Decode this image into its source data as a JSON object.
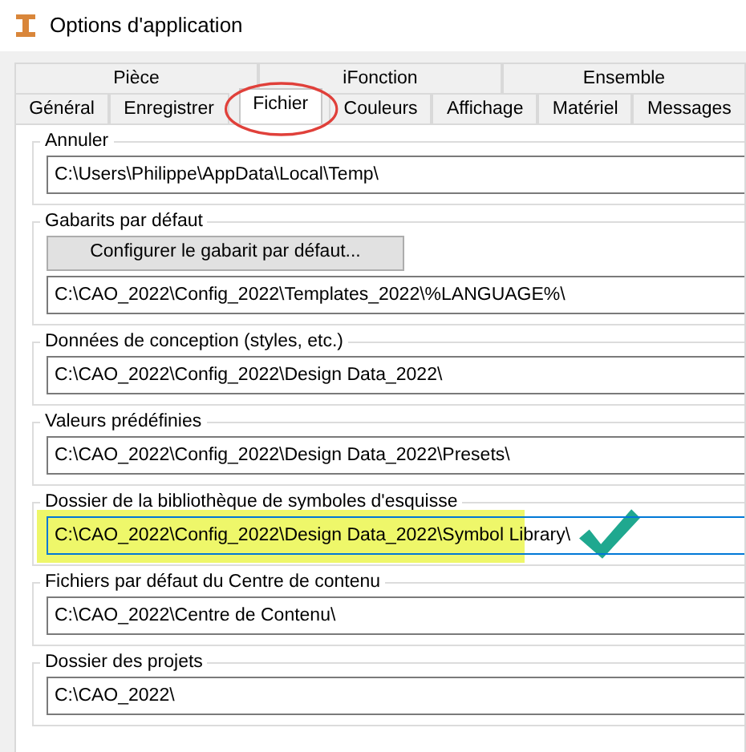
{
  "window": {
    "title": "Options d'application"
  },
  "tabs_top": [
    {
      "label": "Pièce"
    },
    {
      "label": "iFonction"
    },
    {
      "label": "Ensemble"
    }
  ],
  "tabs": [
    {
      "label": "Général",
      "selected": false,
      "circled": false
    },
    {
      "label": "Enregistrer",
      "selected": false,
      "circled": false
    },
    {
      "label": "Fichier",
      "selected": true,
      "circled": true
    },
    {
      "label": "Couleurs",
      "selected": false,
      "circled": false
    },
    {
      "label": "Affichage",
      "selected": false,
      "circled": false
    },
    {
      "label": "Matériel",
      "selected": false,
      "circled": false
    },
    {
      "label": "Messages",
      "selected": false,
      "circled": false
    }
  ],
  "groups": [
    {
      "legend": "Annuler",
      "value": "C:\\Users\\Philippe\\AppData\\Local\\Temp\\",
      "focused": false,
      "highlighted": false,
      "checkmark": false
    },
    {
      "legend": "Gabarits par défaut",
      "button": "Configurer le gabarit par défaut...",
      "value": "C:\\CAO_2022\\Config_2022\\Templates_2022\\%LANGUAGE%\\",
      "focused": false,
      "highlighted": false,
      "checkmark": false
    },
    {
      "legend": "Données de conception (styles, etc.)",
      "value": "C:\\CAO_2022\\Config_2022\\Design Data_2022\\",
      "focused": false,
      "highlighted": false,
      "checkmark": false
    },
    {
      "legend": "Valeurs prédéfinies",
      "value": "C:\\CAO_2022\\Config_2022\\Design Data_2022\\Presets\\",
      "focused": false,
      "highlighted": false,
      "checkmark": false
    },
    {
      "legend": "Dossier de la bibliothèque de symboles d'esquisse",
      "value": "C:\\CAO_2022\\Config_2022\\Design Data_2022\\Symbol Library\\",
      "focused": true,
      "highlighted": true,
      "checkmark": true
    },
    {
      "legend": "Fichiers par défaut du Centre de contenu",
      "value": "C:\\CAO_2022\\Centre de Contenu\\",
      "focused": false,
      "highlighted": false,
      "checkmark": false
    },
    {
      "legend": "Dossier des projets",
      "value": "C:\\CAO_2022\\",
      "focused": false,
      "highlighted": false,
      "checkmark": false
    }
  ]
}
